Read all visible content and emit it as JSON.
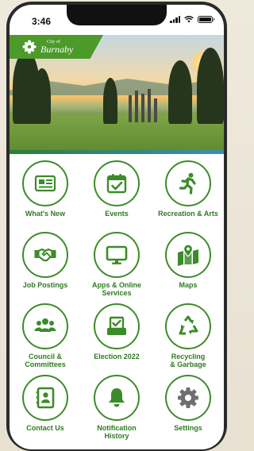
{
  "status": {
    "time": "3:46"
  },
  "hero": {
    "logo_small": "City of",
    "logo_big": "Burnaby"
  },
  "colors": {
    "accent": "#3c8b2a",
    "banner": "#4c9a2a"
  },
  "tiles": [
    {
      "label": "What's New",
      "icon": "newspaper-icon"
    },
    {
      "label": "Events",
      "icon": "calendar-check-icon"
    },
    {
      "label": "Recreation & Arts",
      "icon": "running-person-icon"
    },
    {
      "label": "Job Postings",
      "icon": "handshake-icon"
    },
    {
      "label": "Apps & Online\nServices",
      "icon": "monitor-icon"
    },
    {
      "label": "Maps",
      "icon": "map-pin-icon"
    },
    {
      "label": "Council &\nCommittees",
      "icon": "people-group-icon"
    },
    {
      "label": "Election 2022",
      "icon": "ballot-box-icon"
    },
    {
      "label": "Recycling\n& Garbage",
      "icon": "recycle-icon"
    },
    {
      "label": "Contact Us",
      "icon": "contact-book-icon"
    },
    {
      "label": "Notification\nHistory",
      "icon": "bell-icon"
    },
    {
      "label": "Settings",
      "icon": "gear-icon"
    }
  ]
}
